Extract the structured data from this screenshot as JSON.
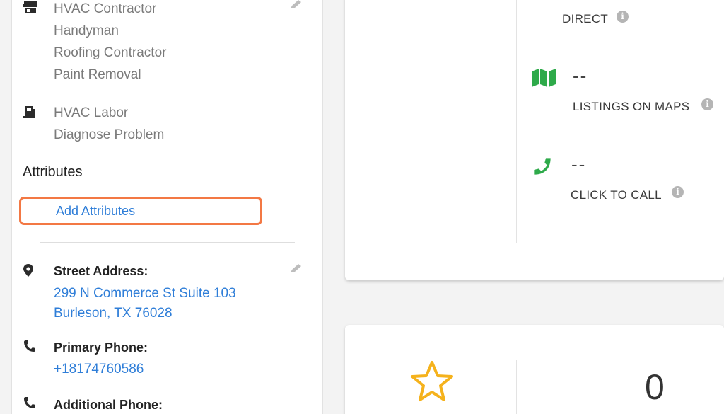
{
  "categories": {
    "primary": [
      "HVAC Contractor",
      "Handyman",
      "Roofing Contractor",
      "Paint Removal"
    ],
    "services": [
      "HVAC Labor",
      "Diagnose Problem"
    ]
  },
  "attributes": {
    "title": "Attributes",
    "add_label": "Add Attributes",
    "highlight_color": "#f37844"
  },
  "address": {
    "label": "Street Address:",
    "line1": "299 N Commerce St Suite 103",
    "line2": "Burleson, TX 76028"
  },
  "primary_phone": {
    "label": "Primary Phone:",
    "value": "+18174760586"
  },
  "additional_phone": {
    "label": "Additional Phone:"
  },
  "metrics": {
    "direct": {
      "label": "DIRECT"
    },
    "maps": {
      "value": "--",
      "label": "LISTINGS ON MAPS",
      "icon": "map-icon"
    },
    "call": {
      "value": "--",
      "label": "CLICK TO CALL",
      "icon": "phone-icon"
    }
  },
  "reviews": {
    "value": "0",
    "icon": "star-icon",
    "star_color": "#f5b21c"
  },
  "info_glyph": "i",
  "accent_green": "#2eaa4a",
  "link_blue": "#2f7ed8"
}
